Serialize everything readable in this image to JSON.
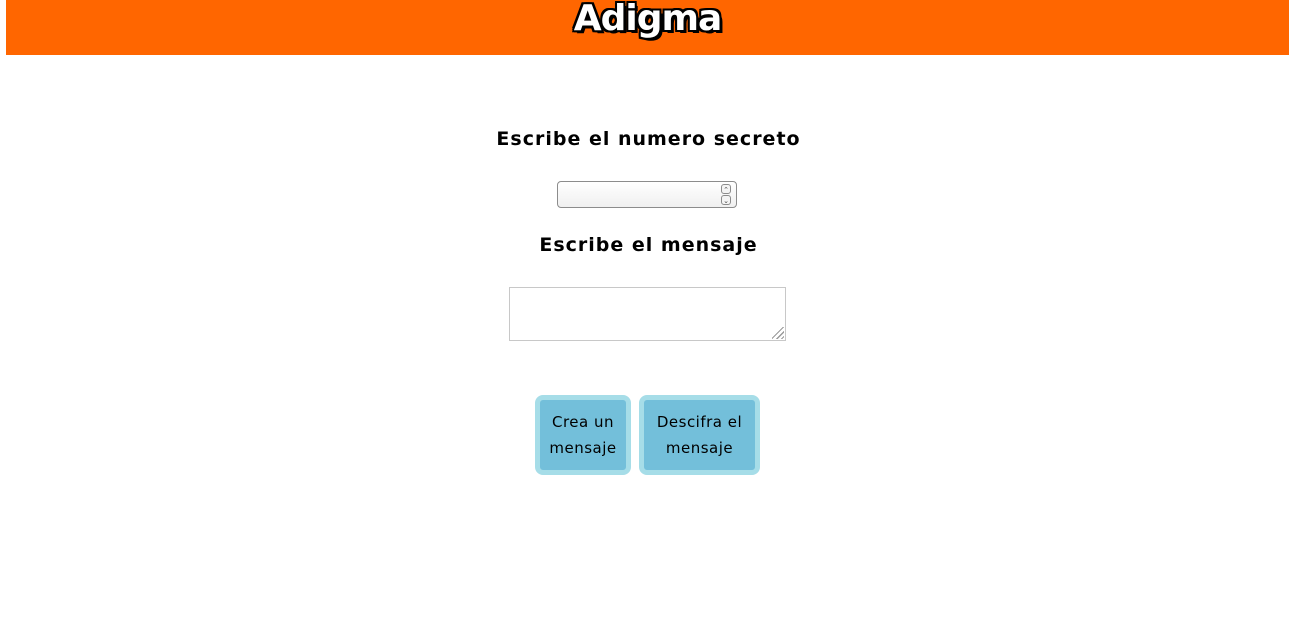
{
  "header": {
    "logo_text": "Adigma",
    "background_color": "#ff6600"
  },
  "form": {
    "number_label": "Escribe el numero secreto",
    "number_value": "",
    "message_label": "Escribe el mensaje",
    "message_value": ""
  },
  "buttons": {
    "crear_line1": "Crea un",
    "crear_line2": "mensaje",
    "descifrar_line1": "Descifra el",
    "descifrar_line2": "mensaje",
    "button_color": "#73bfda",
    "button_border_color": "#a6dde8"
  },
  "icons": {
    "spin_up": "chevron-up-icon",
    "spin_down": "chevron-down-icon",
    "resize_grip": "resize-grip-icon"
  }
}
